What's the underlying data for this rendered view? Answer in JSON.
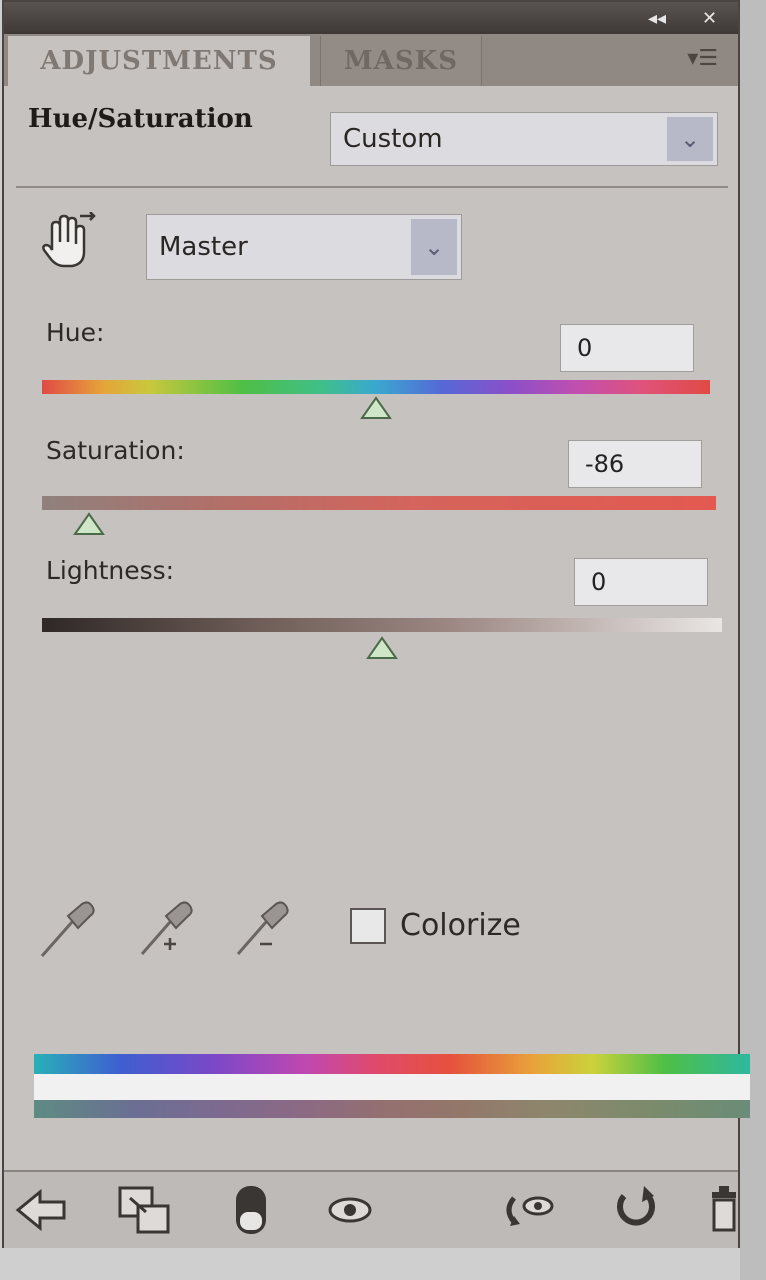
{
  "panel": {
    "tabs": [
      {
        "label": "ADJUSTMENTS",
        "active": true
      },
      {
        "label": "MASKS",
        "active": false
      }
    ],
    "titlebar": {
      "collapse_icon": "double-arrow-icon",
      "close_icon": "close-icon"
    },
    "menu_icon": "panel-menu-icon"
  },
  "adjustment": {
    "title": "Hue/Saturation",
    "preset": {
      "value": "Custom"
    },
    "channel": {
      "value": "Master"
    }
  },
  "sliders": {
    "hue": {
      "label": "Hue:",
      "value": "0",
      "min": -180,
      "max": 180
    },
    "saturation": {
      "label": "Saturation:",
      "value": "-86",
      "min": -100,
      "max": 100
    },
    "lightness": {
      "label": "Lightness:",
      "value": "0",
      "min": -100,
      "max": 100
    }
  },
  "tools": {
    "eyedroppers": [
      "eyedropper-icon",
      "eyedropper-add-icon",
      "eyedropper-subtract-icon"
    ],
    "colorize": {
      "label": "Colorize",
      "checked": false
    }
  },
  "bottom_toolbar": {
    "icons": [
      "return-arrow-icon",
      "clip-to-layer-icon",
      "layer-visibility-mask-icon",
      "eye-icon",
      "view-previous-icon",
      "reset-icon",
      "trash-icon"
    ]
  },
  "colors": {
    "panel_bg": "#c6c2bf",
    "titlebar": "#3e3936",
    "thumb_fill": "#cfe6c8"
  }
}
